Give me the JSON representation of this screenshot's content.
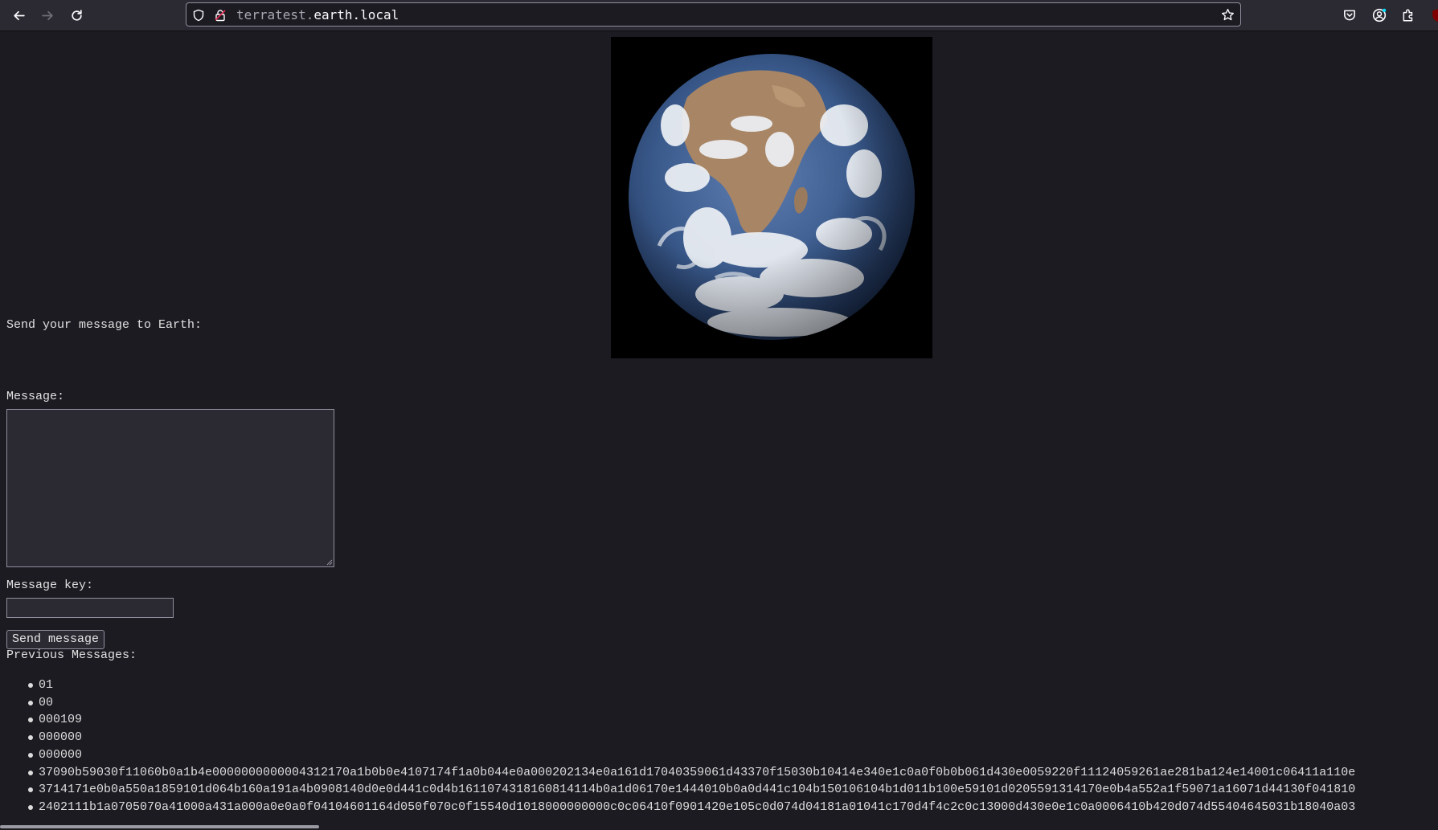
{
  "browser": {
    "url_host_dim": "terratest.",
    "url_host_main": "earth.local",
    "accent": "#2b2a33"
  },
  "page": {
    "image_alt": "Earth",
    "intro": "Send your message to Earth:",
    "message_label": "Message:",
    "message_value": "",
    "key_label": "Message key:",
    "key_value": "",
    "send_button": "Send message",
    "previous_heading": "Previous Messages:",
    "messages": [
      "01",
      "00",
      "000109",
      "000000",
      "000000",
      "37090b59030f11060b0a1b4e0000000000004312170a1b0b0e4107174f1a0b044e0a000202134e0a161d17040359061d43370f15030b10414e340e1c0a0f0b0b061d430e0059220f11124059261ae281ba124e14001c06411a110e",
      "3714171e0b0a550a1859101d064b160a191a4b0908140d0e0d441c0d4b1611074318160814114b0a1d06170e1444010b0a0d441c104b150106104b1d011b100e59101d0205591314170e0b4a552a1f59071a16071d44130f041810",
      "2402111b1a0705070a41000a431a000a0e0a0f04104601164d050f070c0f15540d1018000000000c0c06410f0901420e105c0d074d04181a01041c170d4f4c2c0c13000d430e0e1c0a0006410b420d074d55404645031b18040a03"
    ]
  }
}
